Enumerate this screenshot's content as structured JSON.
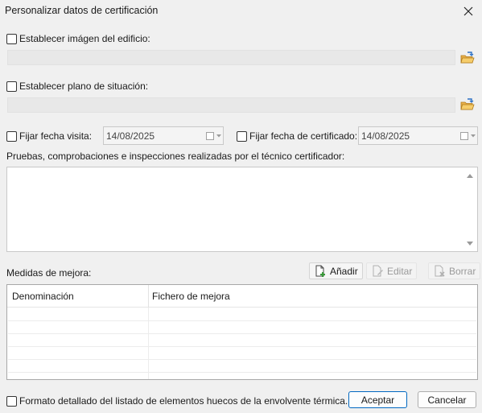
{
  "window": {
    "title": "Personalizar datos de certificación"
  },
  "building_image": {
    "label": "Establecer imágen del edificio:",
    "path_value": ""
  },
  "site_plan": {
    "label": "Establecer plano de situación:",
    "path_value": ""
  },
  "visit_date": {
    "label": "Fijar fecha visita:",
    "value": "14/08/2025"
  },
  "cert_date": {
    "label": "Fijar fecha de certificado:",
    "value": "14/08/2025"
  },
  "tests": {
    "label": "Pruebas, comprobaciones e inspecciones realizadas por el técnico certificador:",
    "value": ""
  },
  "improvements": {
    "label": "Medidas de mejora:",
    "add_label": "Añadir",
    "edit_label": "Editar",
    "delete_label": "Borrar",
    "columns": [
      "Denominación",
      "Fichero de mejora"
    ]
  },
  "detailed_format": {
    "label": "Formato detallado del listado de elementos huecos de la envolvente térmica."
  },
  "buttons": {
    "accept_label": "Aceptar",
    "cancel_label": "Cancelar"
  },
  "colors": {
    "accent": "#0067c0",
    "disabled_text": "#9a9a9a"
  }
}
